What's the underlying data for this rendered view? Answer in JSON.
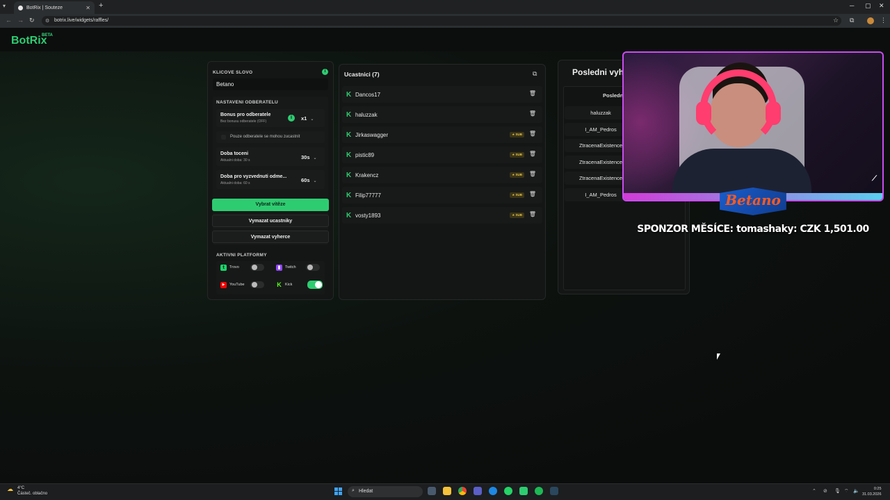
{
  "browser": {
    "tab_title": "BotRix | Souteze",
    "url": "botrix.live/widgets/raffles/",
    "new_tab": "+",
    "tab_close": "✕",
    "window_min": "─",
    "window_max": "▢",
    "window_close": "✕"
  },
  "site": {
    "logo": "BotRix",
    "beta": "BETA"
  },
  "settings": {
    "keyword_label": "KLICOVE SLOVO",
    "keyword_value": "Betano",
    "subs_label": "NASTAVENI ODBERATELU",
    "bonus_title": "Bonus pro odberatele",
    "bonus_sub": "Bez bonusu odberatele (OFF)",
    "bonus_value": "x1",
    "subs_only_label": "Pouze odberatele se mohou zucastnit",
    "spin_title": "Doba toceni",
    "spin_sub": "Aktualni doba: 30 s",
    "spin_value": "30s",
    "claim_title": "Doba pro vyzvednuti odme...",
    "claim_sub": "Aktualni doba: 60 s",
    "claim_value": "60s",
    "pick_winner": "Vybrat vítěze",
    "clear_participants": "Vymazat ucastniky",
    "clear_winners": "Vymazat vyherce",
    "platforms_label": "AKTIVNI PLATFORMY",
    "platforms": [
      {
        "name": "Trovo",
        "on": false,
        "color": "#19d66b"
      },
      {
        "name": "Twitch",
        "on": false,
        "color": "#9146ff"
      },
      {
        "name": "YouTube",
        "on": false,
        "color": "#ff0000"
      },
      {
        "name": "Kick",
        "on": true,
        "color": "#53fc18"
      }
    ]
  },
  "participants": {
    "title": "Ucastnici (7)",
    "sub_badge": "★ SUB",
    "items": [
      {
        "name": "Dancos17",
        "sub": false
      },
      {
        "name": "haluzzak",
        "sub": false
      },
      {
        "name": "Jirkaswagger",
        "sub": true
      },
      {
        "name": "pistic89",
        "sub": true
      },
      {
        "name": "Krakencz",
        "sub": true
      },
      {
        "name": "Filip77777",
        "sub": true
      },
      {
        "name": "vosty1893",
        "sub": true
      }
    ]
  },
  "winners": {
    "title": "Posledni vyhe",
    "sub_title": "Posledn",
    "items": [
      "haluzzak",
      "I_AM_Pedros",
      "ZtracenaExistence",
      "ZtracenaExistence",
      "ZtracenaExistence",
      "I_AM_Pedros"
    ]
  },
  "overlay": {
    "brand": "Betano",
    "sponsor": "SPONZOR MĚSÍCE: tomashaky: CZK 1,501.00"
  },
  "taskbar": {
    "temp": "4°C",
    "weather": "Částeč. oblačno",
    "search": "Hledat",
    "time": "0:25",
    "date": "31.03.2026"
  },
  "colors": {
    "accent": "#2ecc71",
    "background": "#0b0d0c",
    "panel": "#141615"
  }
}
